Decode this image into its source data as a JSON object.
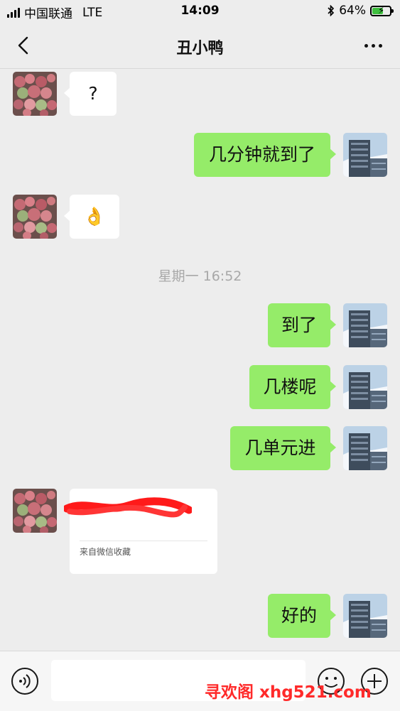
{
  "status_bar": {
    "carrier": "中国联通",
    "network": "LTE",
    "time": "14:09",
    "battery_percent": "64%",
    "battery_level": 0.64,
    "icons": [
      "signal-icon",
      "bluetooth-icon",
      "battery-charging-icon"
    ]
  },
  "nav": {
    "title": "丑小鸭",
    "back_icon": "chevron-left-icon",
    "more_icon": "more-dots-icon"
  },
  "messages": [
    {
      "side": "in",
      "text": "?"
    },
    {
      "side": "out",
      "text": "几分钟就到了"
    },
    {
      "side": "in",
      "text": "👌"
    },
    {
      "type": "timestamp",
      "text": "星期一 16:52"
    },
    {
      "side": "out",
      "text": "到了"
    },
    {
      "side": "out",
      "text": "几楼呢"
    },
    {
      "side": "out",
      "text": "几单元进"
    },
    {
      "side": "in",
      "type": "card",
      "source": "来自微信收藏"
    },
    {
      "side": "out",
      "text": "好的"
    }
  ],
  "input_bar": {
    "value": "",
    "voice_icon": "voice-icon",
    "emoji_icon": "emoji-icon",
    "plus_icon": "plus-icon"
  },
  "watermark": "寻欢阁 xhg521.com",
  "colors": {
    "background": "#ededed",
    "outgoing_bubble": "#95ec69",
    "incoming_bubble": "#ffffff",
    "timestamp": "#a8a8a8",
    "watermark": "#ff2a2a"
  }
}
